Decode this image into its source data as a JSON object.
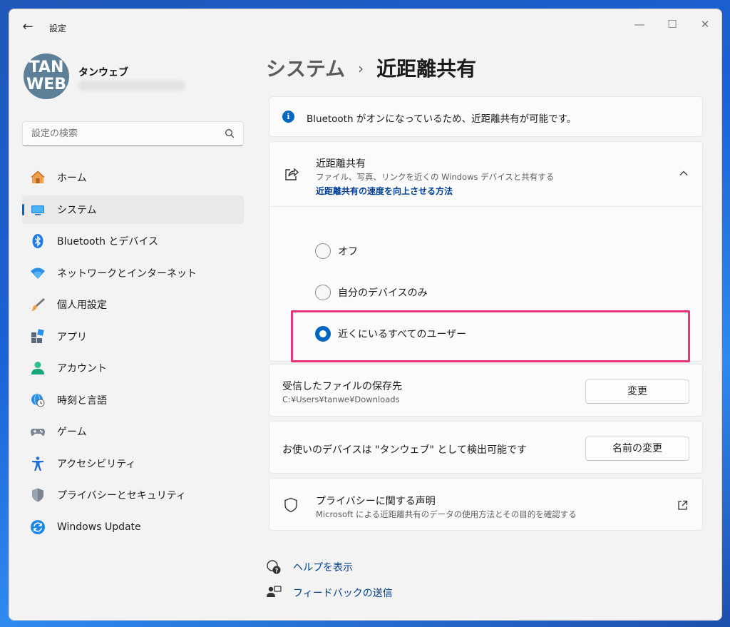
{
  "window": {
    "app_title": "設定",
    "back_label": "←",
    "minimize_label": "—",
    "maximize_label": "☐",
    "close_label": "✕"
  },
  "user": {
    "avatar_line1": "TAN",
    "avatar_line2": "WEB",
    "name": "タンウェブ"
  },
  "search": {
    "placeholder": "設定の検索"
  },
  "sidebar": {
    "items": [
      {
        "label": "ホーム",
        "icon": "home-icon"
      },
      {
        "label": "システム",
        "icon": "system-icon",
        "active": true
      },
      {
        "label": "Bluetooth とデバイス",
        "icon": "bluetooth-icon"
      },
      {
        "label": "ネットワークとインターネット",
        "icon": "wifi-icon"
      },
      {
        "label": "個人用設定",
        "icon": "brush-icon"
      },
      {
        "label": "アプリ",
        "icon": "apps-icon"
      },
      {
        "label": "アカウント",
        "icon": "account-icon"
      },
      {
        "label": "時刻と言語",
        "icon": "time-language-icon"
      },
      {
        "label": "ゲーム",
        "icon": "gamepad-icon"
      },
      {
        "label": "アクセシビリティ",
        "icon": "accessibility-icon"
      },
      {
        "label": "プライバシーとセキュリティ",
        "icon": "shield-icon"
      },
      {
        "label": "Windows Update",
        "icon": "update-icon"
      }
    ]
  },
  "main": {
    "breadcrumb_parent": "システム",
    "breadcrumb_separator": "›",
    "page_title": "近距離共有",
    "info_text": "Bluetooth がオンになっているため、近距離共有が可能です。",
    "nearby_share": {
      "title": "近距離共有",
      "subtitle": "ファイル、写真、リンクを近くの Windows デバイスと共有する",
      "link": "近距離共有の速度を向上させる方法",
      "options": [
        {
          "label": "オフ",
          "checked": false
        },
        {
          "label": "自分のデバイスのみ",
          "checked": false
        },
        {
          "label": "近くにいるすべてのユーザー",
          "checked": true
        }
      ]
    },
    "save_location": {
      "title": "受信したファイルの保存先",
      "path": "C:¥Users¥tanwe¥Downloads",
      "button": "変更"
    },
    "device_name": {
      "text": "お使いのデバイスは \"タンウェブ\" として検出可能です",
      "button": "名前の変更"
    },
    "privacy": {
      "title": "プライバシーに関する声明",
      "subtitle": "Microsoft による近距離共有のデータの使用方法とその目的を確認する"
    },
    "help_link": "ヘルプを表示",
    "feedback_link": "フィードバックの送信"
  },
  "colors": {
    "accent": "#0067c0",
    "highlight": "#e8337a",
    "link": "#003e92"
  }
}
